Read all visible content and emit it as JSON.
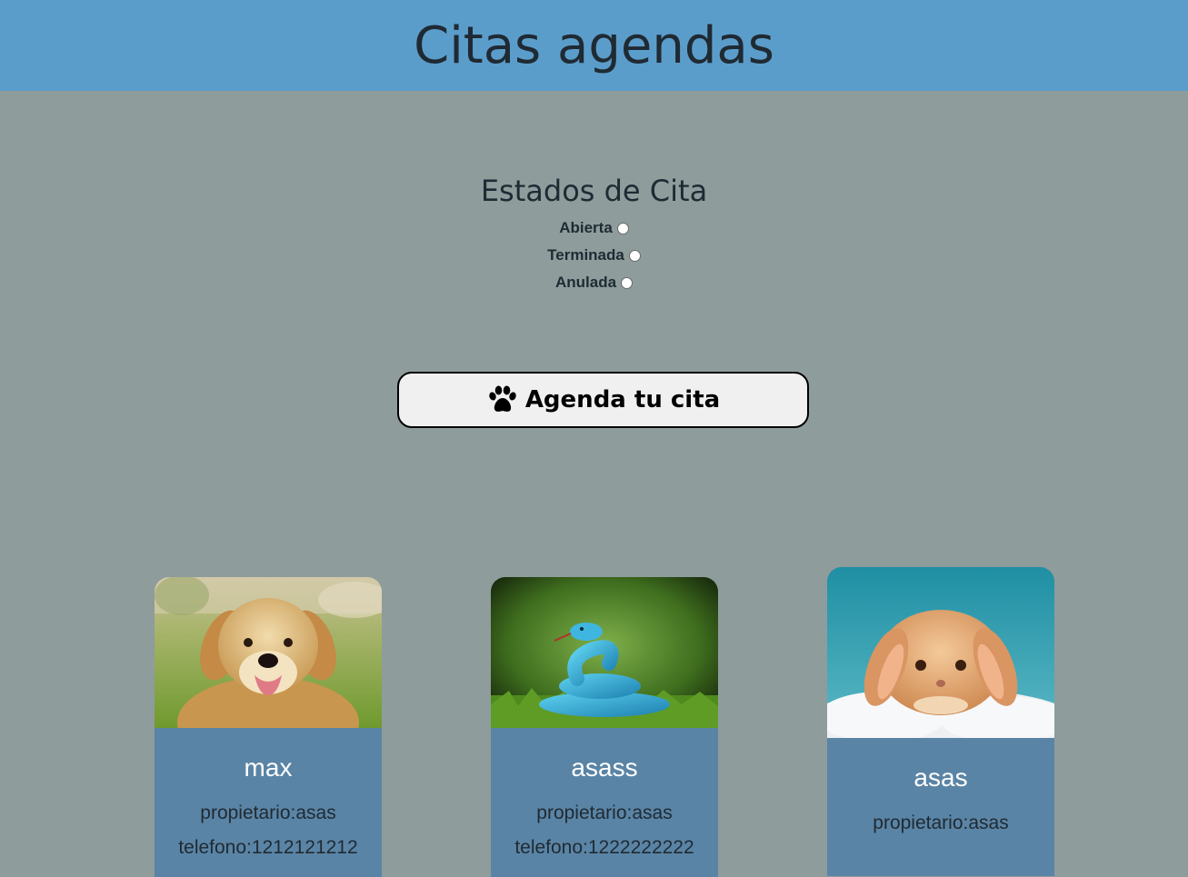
{
  "header": {
    "title": "Citas agendas"
  },
  "estados": {
    "title": "Estados de Cita",
    "options": [
      {
        "label": "Abierta"
      },
      {
        "label": "Terminada"
      },
      {
        "label": "Anulada"
      }
    ]
  },
  "agenda_button": {
    "label": "Agenda tu cita",
    "icon": "paw-icon"
  },
  "cards": [
    {
      "name": "max",
      "propietario": "propietario:asas",
      "telefono": "telefono:1212121212",
      "photo": "golden retriever dog"
    },
    {
      "name": "asass",
      "propietario": "propietario:asas",
      "telefono": "telefono:1222222222",
      "photo": "blue snake"
    },
    {
      "name": "asas",
      "propietario": "propietario:asas",
      "photo": "lop-eared rabbit"
    }
  ],
  "colors": {
    "header_bg": "#5b9dca",
    "page_bg": "#8e9c9c",
    "card_bg": "#5a84a5"
  }
}
